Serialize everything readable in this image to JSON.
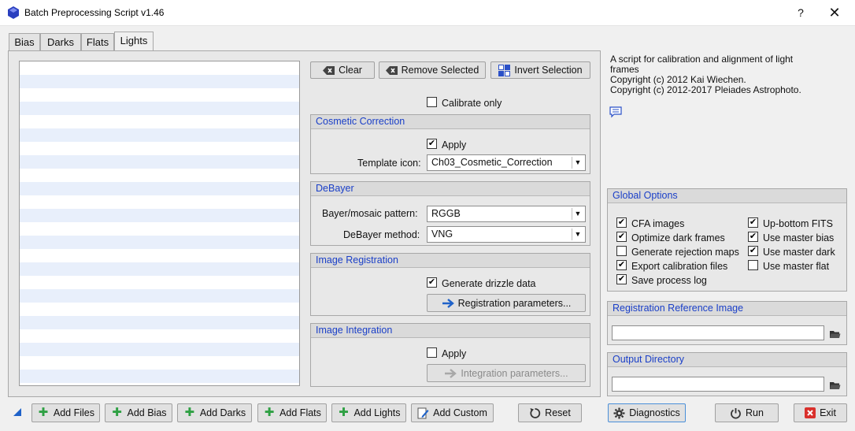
{
  "window": {
    "title": "Batch Preprocessing Script v1.46",
    "help": "?",
    "close": "✕"
  },
  "tabs": [
    "Bias",
    "Darks",
    "Flats",
    "Lights"
  ],
  "active_tab": "Lights",
  "toolbar": {
    "clear": "Clear",
    "remove_selected": "Remove Selected",
    "invert_selection": "Invert Selection"
  },
  "calibrate_only": {
    "label": "Calibrate only",
    "checked": false
  },
  "cosmetic": {
    "title": "Cosmetic Correction",
    "apply_label": "Apply",
    "apply_checked": true,
    "template_label": "Template icon:",
    "template_value": "Ch03_Cosmetic_Correction"
  },
  "debayer": {
    "title": "DeBayer",
    "pattern_label": "Bayer/mosaic pattern:",
    "pattern_value": "RGGB",
    "method_label": "DeBayer method:",
    "method_value": "VNG"
  },
  "registration": {
    "title": "Image Registration",
    "drizzle_label": "Generate drizzle data",
    "drizzle_checked": true,
    "params_button": "Registration parameters..."
  },
  "integration": {
    "title": "Image Integration",
    "apply_label": "Apply",
    "apply_checked": false,
    "params_button": "Integration parameters..."
  },
  "info": {
    "line1": "A script for calibration and alignment of light",
    "line2": "frames",
    "line3": "Copyright (c) 2012 Kai Wiechen.",
    "line4": "Copyright (c) 2012-2017 Pleiades Astrophoto."
  },
  "global_options": {
    "title": "Global Options",
    "left": [
      {
        "label": "CFA images",
        "checked": true
      },
      {
        "label": "Optimize dark frames",
        "checked": true
      },
      {
        "label": "Generate rejection maps",
        "checked": false
      },
      {
        "label": "Export calibration files",
        "checked": true
      },
      {
        "label": "Save process log",
        "checked": true
      }
    ],
    "right": [
      {
        "label": "Up-bottom FITS",
        "checked": true
      },
      {
        "label": "Use master bias",
        "checked": true
      },
      {
        "label": "Use master dark",
        "checked": true
      },
      {
        "label": "Use master flat",
        "checked": false
      }
    ]
  },
  "reg_reference": {
    "title": "Registration Reference Image",
    "value": ""
  },
  "output_dir": {
    "title": "Output Directory",
    "value": ""
  },
  "bottom": {
    "add_files": "Add Files",
    "add_bias": "Add Bias",
    "add_darks": "Add Darks",
    "add_flats": "Add Flats",
    "add_lights": "Add Lights",
    "add_custom": "Add Custom",
    "reset": "Reset",
    "diagnostics": "Diagnostics",
    "run": "Run",
    "exit": "Exit"
  },
  "colors": {
    "accent_blue": "#1a3fc8",
    "add_green": "#2ea043",
    "exit_red": "#d9302c",
    "stripe_blue": "#e8effb"
  }
}
